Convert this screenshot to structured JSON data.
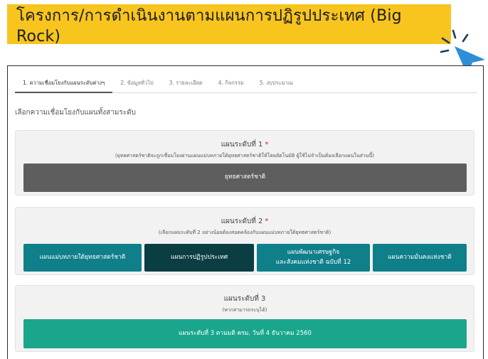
{
  "banner": {
    "title": "โครงการ/การดำเนินงานตามแผนการปฏิรูปประเทศ (Big Rock)"
  },
  "tabs": [
    {
      "label": "1. ความเชื่อมโยงกับแผนระดับต่างๆ",
      "active": true
    },
    {
      "label": "2. ข้อมูลทั่วไป",
      "active": false
    },
    {
      "label": "3. รายละเอียด",
      "active": false
    },
    {
      "label": "4. กิจกรรม",
      "active": false
    },
    {
      "label": "5. งบประมาณ",
      "active": false
    }
  ],
  "section": {
    "title": "เลือกความเชื่อมโยงกับแผนทั้งสามระดับ"
  },
  "level1": {
    "title": "แผนระดับที่ 1",
    "required": "*",
    "hint": "(ยุทธศาสตร์ชาติจะถูกเชื่อมโยงผ่านแผนแม่บทภายใต้ยุทธศาสตร์ชาติให้โดยอัตโนมัติ ผู้ใช้ไม่จำเป็นต้องเลือกแผนในส่วนนี้)",
    "button": "ยุทธศาสตร์ชาติ"
  },
  "level2": {
    "title": "แผนระดับที่ 2",
    "required": "*",
    "hint": "(เลือกแผนระดับที่ 2 อย่างน้อยต้องสอดคล้องกับแผนแม่บทภายใต้ยุทธศาสตร์ชาติ)",
    "options": [
      {
        "line1": "แผนแม่บทภายใต้ยุทธศาสตร์ชาติ",
        "line2": ""
      },
      {
        "line1": "แผนการปฏิรูปประเทศ",
        "line2": ""
      },
      {
        "line1": "แผนพัฒนาเศรษฐกิจ",
        "line2": "และสังคมแห่งชาติ ฉบับที่ 12"
      },
      {
        "line1": "แผนความมั่นคงแห่งชาติ",
        "line2": ""
      }
    ]
  },
  "level3": {
    "title": "แผนระดับที่ 3",
    "hint": "(หากสามารถระบุได้)",
    "button": "แผนระดับที่ 3 ตามมติ ครม. วันที่ 4 ธันวาคม 2560"
  },
  "colors": {
    "banner": "#f7c51e",
    "cursor": "#2d8fd8",
    "teal": "#0f7f8a",
    "teal_selected": "#0b3e43",
    "green": "#19a68d",
    "gray": "#5e5e5e",
    "required": "#d21f1f"
  },
  "icons": {
    "cursor": "pointer-click-icon"
  }
}
